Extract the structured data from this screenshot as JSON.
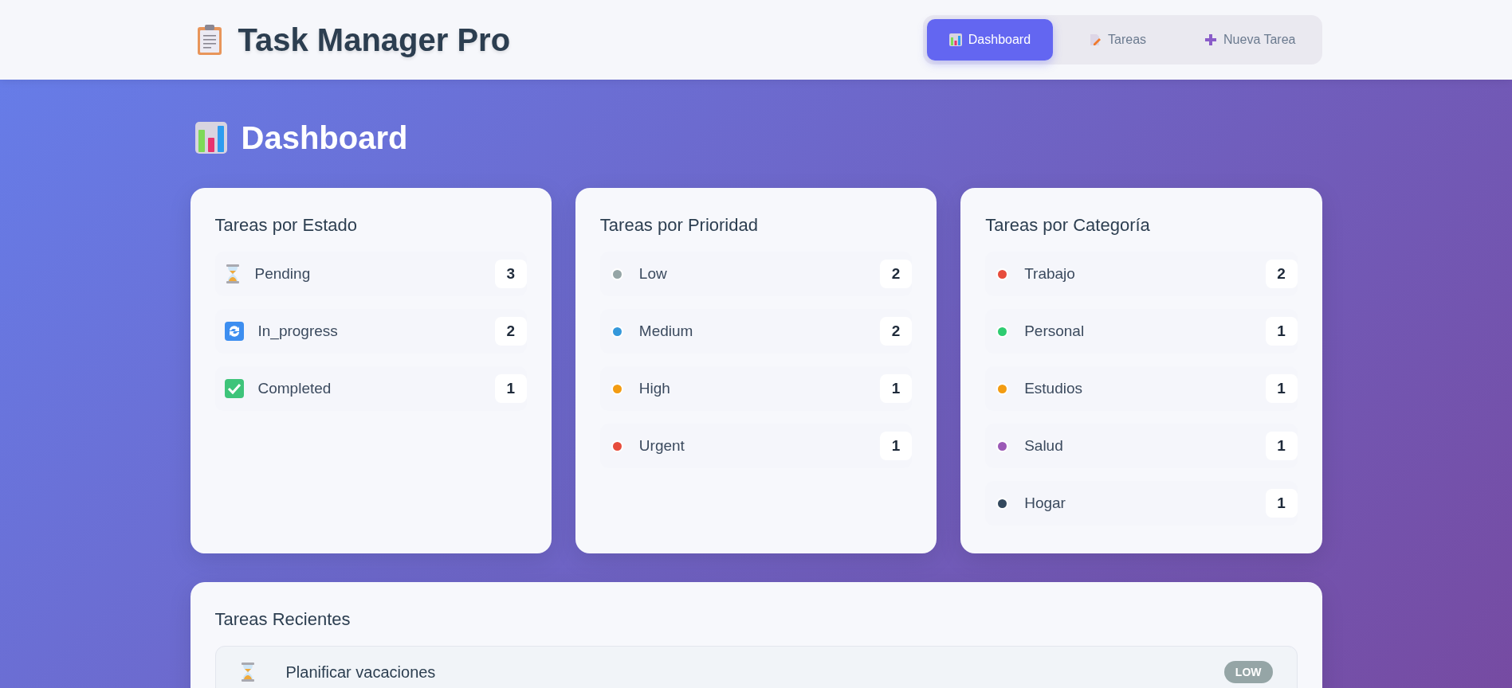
{
  "app": {
    "title": "Task Manager Pro"
  },
  "nav": [
    {
      "label": "Dashboard",
      "kind": "chart",
      "selected": true
    },
    {
      "label": "Tareas",
      "kind": "document",
      "selected": false
    },
    {
      "label": "Nueva Tarea",
      "kind": "plus",
      "selected": false
    }
  ],
  "page_title": "Dashboard",
  "status_card": {
    "title": "Tareas por Estado",
    "items": [
      {
        "label": "Pending",
        "kind": "pending",
        "count": "3"
      },
      {
        "label": "In_progress",
        "kind": "in_progress",
        "count": "2"
      },
      {
        "label": "Completed",
        "kind": "completed",
        "count": "1"
      }
    ]
  },
  "priority_card": {
    "title": "Tareas por Prioridad",
    "items": [
      {
        "label": "Low",
        "color": "#95a5a6",
        "count": "2"
      },
      {
        "label": "Medium",
        "color": "#3498db",
        "count": "2"
      },
      {
        "label": "High",
        "color": "#f39c12",
        "count": "1"
      },
      {
        "label": "Urgent",
        "color": "#e74c3c",
        "count": "1"
      }
    ]
  },
  "category_card": {
    "title": "Tareas por Categoría",
    "items": [
      {
        "label": "Trabajo",
        "color": "#e74c3c",
        "count": "2"
      },
      {
        "label": "Personal",
        "color": "#2ecc71",
        "count": "1"
      },
      {
        "label": "Estudios",
        "color": "#f39c12",
        "count": "1"
      },
      {
        "label": "Salud",
        "color": "#9b59b6",
        "count": "1"
      },
      {
        "label": "Hogar",
        "color": "#34495e",
        "count": "1"
      }
    ]
  },
  "recent": {
    "title": "Tareas Recientes",
    "tasks": [
      {
        "title": "Planificar vacaciones",
        "kind": "pending",
        "priority": "LOW",
        "color": "#95a5a6"
      }
    ]
  }
}
